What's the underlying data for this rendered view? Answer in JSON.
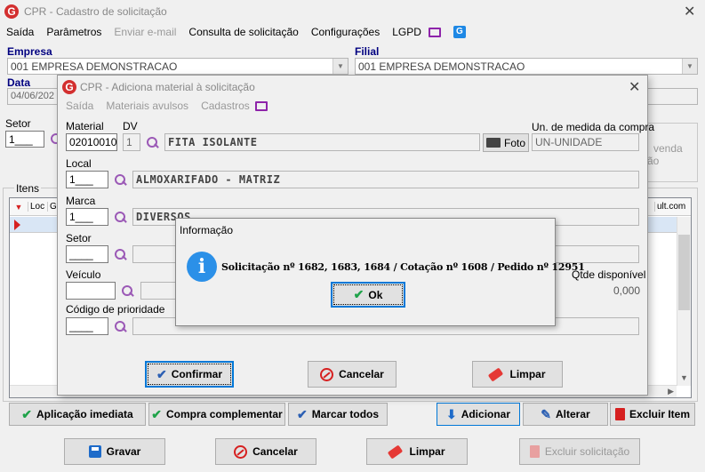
{
  "main_window": {
    "title": "CPR - Cadastro de solicitação",
    "menu": [
      "Saída",
      "Parâmetros",
      "Enviar e-mail",
      "Consulta de solicitação",
      "Configurações",
      "LGPD"
    ],
    "empresa_label": "Empresa",
    "empresa_value": "001 EMPRESA DEMONSTRACAO",
    "filial_label": "Filial",
    "filial_value": "001 EMPRESA DEMONSTRACAO",
    "data_label": "Data",
    "data_value": "04/06/202",
    "setor_label": "Setor",
    "setor_value": "1___",
    "itens_label": "Itens",
    "grid_headers": [
      "Loc",
      "G",
      "ult.com"
    ],
    "side_text_1": "venda",
    "side_text_2": "ão",
    "btn_aplicacao": "Aplicação imediata",
    "btn_compra": "Compra complementar",
    "btn_marcar": "Marcar todos",
    "btn_adicionar": "Adicionar",
    "btn_alterar": "Alterar",
    "btn_excluir_item": "Excluir Item",
    "btn_gravar": "Gravar",
    "btn_cancelar": "Cancelar",
    "btn_limpar": "Limpar",
    "btn_excluir_solicitacao": "Excluir solicitação"
  },
  "material_window": {
    "title": "CPR - Adiciona material à solicitação",
    "menu": [
      "Saída",
      "Materiais avulsos",
      "Cadastros"
    ],
    "material_label": "Material",
    "material_value": "02010010",
    "dv_label": "DV",
    "dv_value": "1",
    "material_desc": "FITA ISOLANTE",
    "foto_label": "Foto",
    "unidade_label": "Un. de medida da compra",
    "unidade_value": "UN-UNIDADE",
    "local_label": "Local",
    "local_value": "1___",
    "local_desc": "ALMOXARIFADO  - MATRIZ",
    "marca_label": "Marca",
    "marca_value": "1___",
    "marca_desc": "DIVERSOS",
    "setor_label": "Setor",
    "setor_value": "____",
    "veiculo_label": "Veículo",
    "qtde_label": "Qtde disponível",
    "qtde_value": "0,000",
    "prioridade_label": "Código de prioridade",
    "prioridade_value": "____",
    "btn_confirmar": "Confirmar",
    "btn_cancelar": "Cancelar",
    "btn_limpar": "Limpar"
  },
  "info_dialog": {
    "title": "Informação",
    "message": "Solicitação nº 1682, 1683, 1684 / Cotação nº 1608 / Pedido nº 12951",
    "ok_label": "Ok"
  }
}
